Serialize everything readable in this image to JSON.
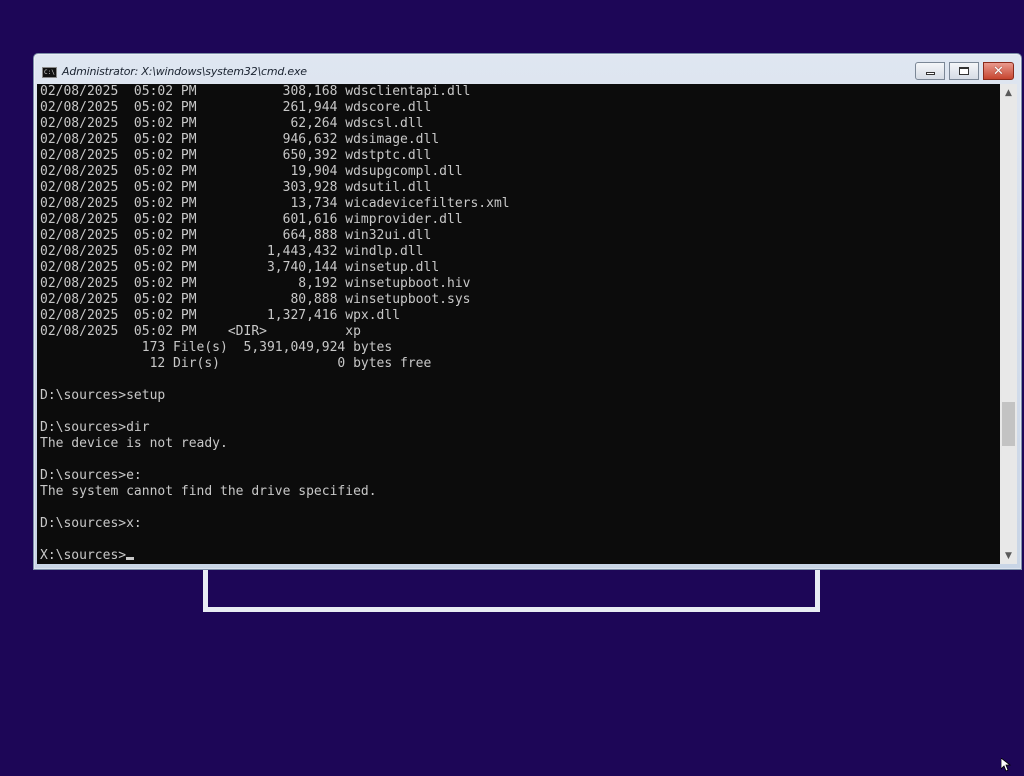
{
  "window": {
    "title": "Administrator: X:\\windows\\system32\\cmd.exe",
    "icon_label": "C:\\"
  },
  "console": {
    "lines": [
      "02/08/2025  05:02 PM           308,168 wdsclientapi.dll",
      "02/08/2025  05:02 PM           261,944 wdscore.dll",
      "02/08/2025  05:02 PM            62,264 wdscsl.dll",
      "02/08/2025  05:02 PM           946,632 wdsimage.dll",
      "02/08/2025  05:02 PM           650,392 wdstptc.dll",
      "02/08/2025  05:02 PM            19,904 wdsupgcompl.dll",
      "02/08/2025  05:02 PM           303,928 wdsutil.dll",
      "02/08/2025  05:02 PM            13,734 wicadevicefilters.xml",
      "02/08/2025  05:02 PM           601,616 wimprovider.dll",
      "02/08/2025  05:02 PM           664,888 win32ui.dll",
      "02/08/2025  05:02 PM         1,443,432 windlp.dll",
      "02/08/2025  05:02 PM         3,740,144 winsetup.dll",
      "02/08/2025  05:02 PM             8,192 winsetupboot.hiv",
      "02/08/2025  05:02 PM            80,888 winsetupboot.sys",
      "02/08/2025  05:02 PM         1,327,416 wpx.dll",
      "02/08/2025  05:02 PM    <DIR>          xp",
      "             173 File(s)  5,391,049,924 bytes",
      "              12 Dir(s)               0 bytes free",
      "",
      "D:\\sources>setup",
      "",
      "D:\\sources>dir",
      "The device is not ready.",
      "",
      "D:\\sources>e:",
      "The system cannot find the drive specified.",
      "",
      "D:\\sources>x:",
      ""
    ],
    "prompt": "X:\\sources>"
  },
  "scrollbar": {
    "up_icon": "chevron-up-icon",
    "down_icon": "chevron-down-icon"
  },
  "colors": {
    "desktop": "#1d0657",
    "console_bg": "#0c0c0c",
    "console_text": "#c8c8c8",
    "close_button": "#c6452f"
  }
}
